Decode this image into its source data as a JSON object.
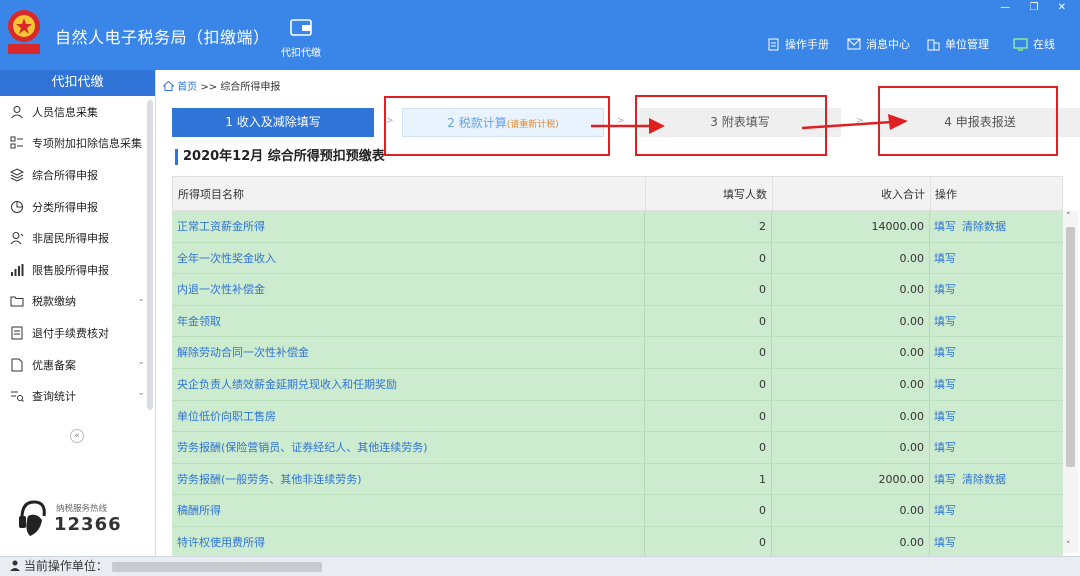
{
  "header": {
    "app_title": "自然人电子税务局（扣缴端）",
    "tab_label": "代扣代缴",
    "nav": {
      "manual": "操作手册",
      "messages": "消息中心",
      "unit": "单位管理",
      "online": "在线"
    },
    "window_controls": "— ❐ ✕"
  },
  "sidebar": {
    "title": "代扣代缴",
    "items": [
      {
        "label": "人员信息采集"
      },
      {
        "label": "专项附加扣除信息采集"
      },
      {
        "label": "综合所得申报"
      },
      {
        "label": "分类所得申报"
      },
      {
        "label": "非居民所得申报"
      },
      {
        "label": "限售股所得申报"
      },
      {
        "label": "税款缴纳"
      },
      {
        "label": "退付手续费核对"
      },
      {
        "label": "优惠备案"
      },
      {
        "label": "查询统计"
      }
    ],
    "collapse_glyph": "«",
    "hotline_label": "纳税服务热线",
    "hotline_number": "12366"
  },
  "breadcrumb": {
    "home": "首页",
    "sep": ">>",
    "current": "综合所得申报"
  },
  "steps": [
    {
      "label": "1 收入及减除填写"
    },
    {
      "label": "2 税款计算",
      "note": "(请重新计税)"
    },
    {
      "label": "3 附表填写"
    },
    {
      "label": "4 申报表报送"
    }
  ],
  "step_sep": ">",
  "table_title": "2020年12月  综合所得预扣预缴表",
  "table": {
    "headers": [
      "所得项目名称",
      "填写人数",
      "收入合计",
      "操作"
    ],
    "rows": [
      {
        "name": "正常工资薪金所得",
        "count": "2",
        "income": "14000.00",
        "fill": "填写",
        "clear": "清除数据"
      },
      {
        "name": "全年一次性奖金收入",
        "count": "0",
        "income": "0.00",
        "fill": "填写",
        "clear": ""
      },
      {
        "name": "内退一次性补偿金",
        "count": "0",
        "income": "0.00",
        "fill": "填写",
        "clear": ""
      },
      {
        "name": "年金领取",
        "count": "0",
        "income": "0.00",
        "fill": "填写",
        "clear": ""
      },
      {
        "name": "解除劳动合同一次性补偿金",
        "count": "0",
        "income": "0.00",
        "fill": "填写",
        "clear": ""
      },
      {
        "name": "央企负责人绩效薪金延期兑现收入和任期奖励",
        "count": "0",
        "income": "0.00",
        "fill": "填写",
        "clear": ""
      },
      {
        "name": "单位低价向职工售房",
        "count": "0",
        "income": "0.00",
        "fill": "填写",
        "clear": ""
      },
      {
        "name": "劳务报酬(保险营销员、证券经纪人、其他连续劳务)",
        "count": "0",
        "income": "0.00",
        "fill": "填写",
        "clear": ""
      },
      {
        "name": "劳务报酬(一般劳务、其他非连续劳务)",
        "count": "1",
        "income": "2000.00",
        "fill": "填写",
        "clear": "清除数据"
      },
      {
        "name": "稿酬所得",
        "count": "0",
        "income": "0.00",
        "fill": "填写",
        "clear": ""
      },
      {
        "name": "特许权使用费所得",
        "count": "0",
        "income": "0.00",
        "fill": "填写",
        "clear": ""
      }
    ]
  },
  "statusbar": {
    "label": "当前操作单位："
  },
  "colors": {
    "header_blue": "#3a86e8",
    "accent_blue": "#2f74d6",
    "row_green": "#cdebce",
    "annotation_red": "#e02020"
  }
}
